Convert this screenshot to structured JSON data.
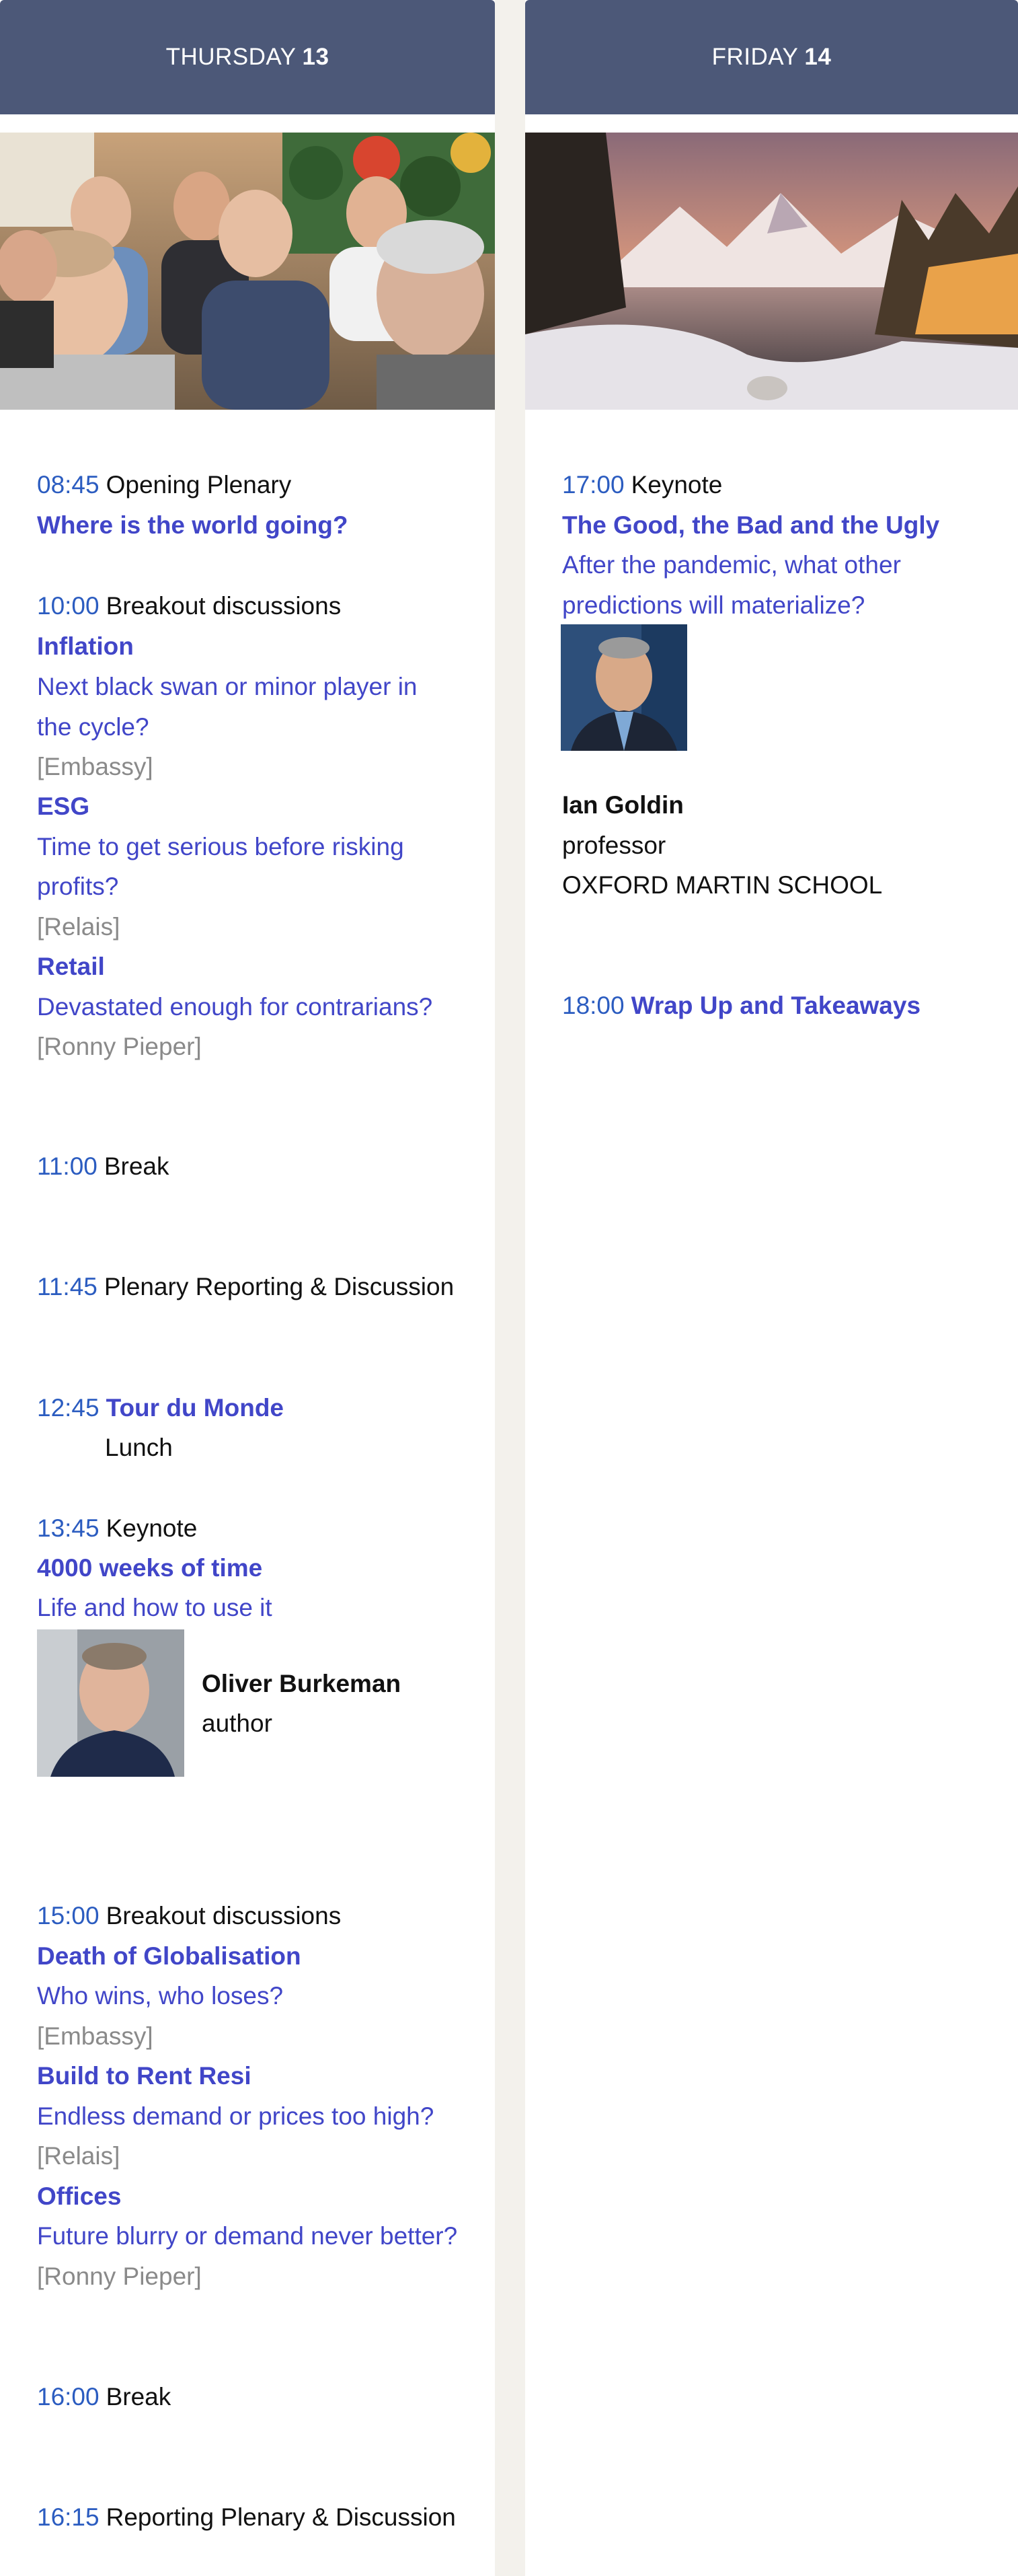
{
  "days": [
    {
      "name": "THURSDAY",
      "number": "13",
      "photo": "group-of-seated-participants",
      "items": {
        "opening": {
          "time": "08:45",
          "label": "Opening Plenary",
          "title": "Where is the world going?"
        },
        "breakout1": {
          "time": "10:00",
          "label": "Breakout discussions",
          "sessions": [
            {
              "title": "Inflation",
              "subtitle_l1": "Next black swan or minor player in",
              "subtitle_l2": "the cycle?",
              "room": "[Embassy]"
            },
            {
              "title": "ESG",
              "subtitle_l1": "Time to get serious before risking",
              "subtitle_l2": "profits?",
              "room": "[Relais]"
            },
            {
              "title": "Retail",
              "subtitle_l1": "Devastated enough for contrarians?",
              "room": "[Ronny Pieper]"
            }
          ]
        },
        "break1": {
          "time": "11:00",
          "label": "Break"
        },
        "plenary": {
          "time": "11:45",
          "label": "Plenary Reporting & Discussion"
        },
        "lunch": {
          "time": "12:45",
          "title": "Tour du Monde",
          "label": "Lunch"
        },
        "keynote": {
          "time": "13:45",
          "label": "Keynote",
          "title": "4000 weeks of time",
          "subtitle": "Life and how to use it",
          "speaker": {
            "name": "Oliver Burkeman",
            "role": "author",
            "photo": "speaker-portrait"
          }
        },
        "breakout2": {
          "time": "15:00",
          "label": "Breakout discussions",
          "sessions": [
            {
              "title": "Death of Globalisation",
              "subtitle_l1": "Who wins, who loses?",
              "room": "[Embassy]"
            },
            {
              "title": "Build to Rent Resi",
              "subtitle_l1": "Endless demand or prices too high?",
              "room": "[Relais]"
            },
            {
              "title": "Offices",
              "subtitle_l1": "Future blurry or demand never better?",
              "room": "[Ronny Pieper]"
            }
          ]
        },
        "break2": {
          "time": "16:00",
          "label": "Break"
        },
        "reporting": {
          "time": "16:15",
          "label": "Reporting Plenary & Discussion"
        }
      }
    },
    {
      "name": "FRIDAY",
      "number": "14",
      "photo": "snowy-mountain-lake-sunset",
      "items": {
        "keynote": {
          "time": "17:00",
          "label": "Keynote",
          "title": "The Good, the Bad and the Ugly",
          "subtitle_l1": "After the pandemic, what other",
          "subtitle_l2": "predictions will materialize?",
          "speaker": {
            "name": "Ian Goldin",
            "role": "professor",
            "org": "OXFORD MARTIN SCHOOL",
            "photo": "speaker-portrait"
          }
        },
        "wrapup": {
          "time": "18:00",
          "title": "Wrap Up and Takeaways"
        }
      }
    }
  ],
  "colors": {
    "header_bg": "#4c5878",
    "time": "#2b5cc0",
    "link": "#4146c8",
    "room": "#8a8a8a",
    "page_bg": "#f3f1ec"
  }
}
